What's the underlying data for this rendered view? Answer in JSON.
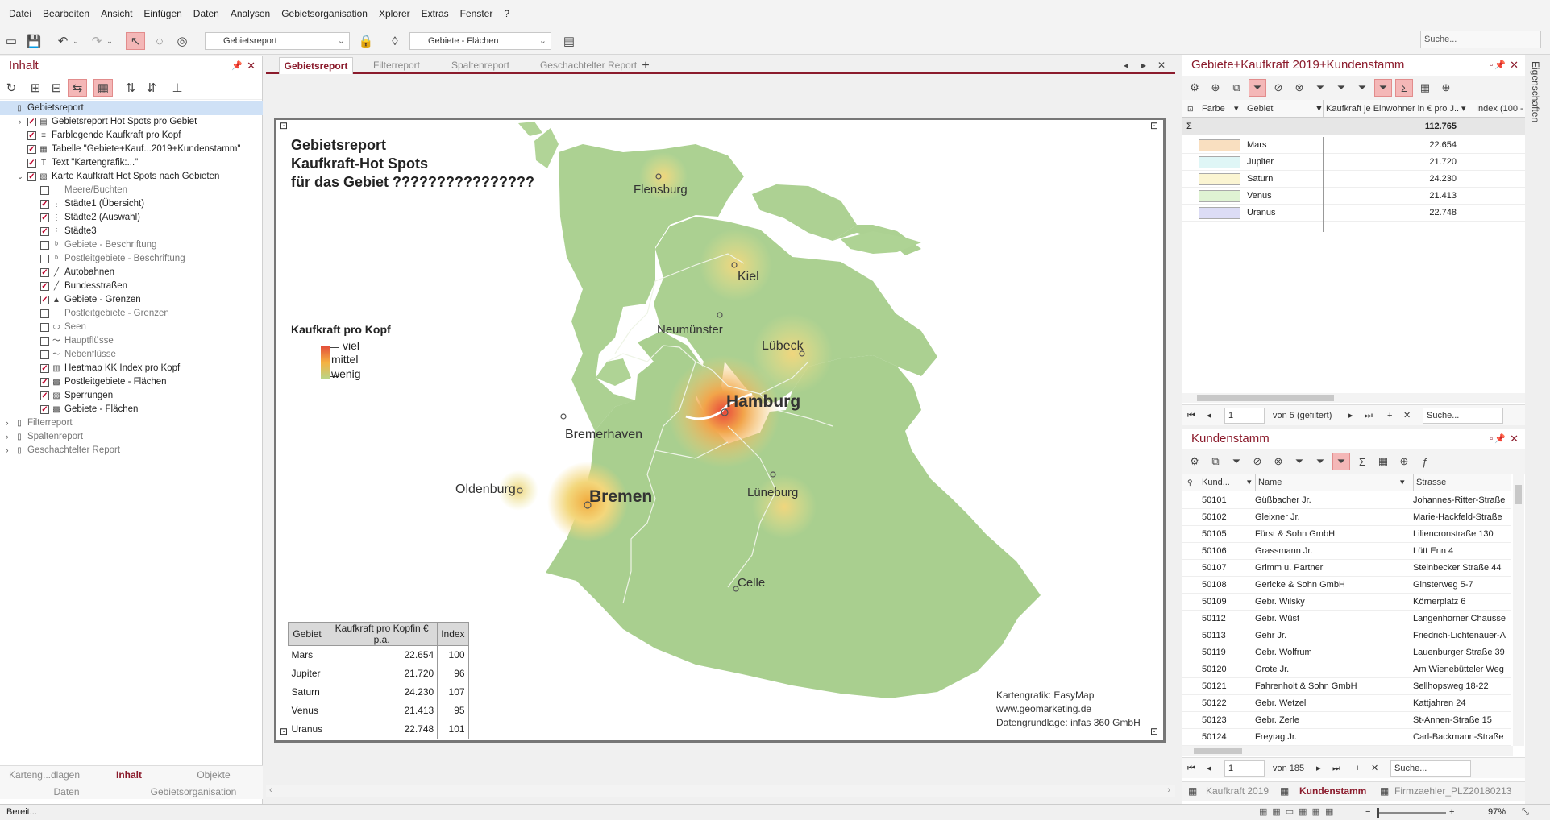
{
  "menu": [
    "Datei",
    "Bearbeiten",
    "Ansicht",
    "Einfügen",
    "Daten",
    "Analysen",
    "Gebietsorganisation",
    "Xplorer",
    "Extras",
    "Fenster",
    "?"
  ],
  "toolbar": {
    "report_combo": "Gebietsreport",
    "layer_combo": "Gebiete - Flächen",
    "search": "Suche..."
  },
  "left": {
    "title": "Inhalt",
    "tree": [
      {
        "label": "Gebietsreport",
        "lvl": 0,
        "exp": "",
        "cb": "none",
        "ic": "doc",
        "sel": true
      },
      {
        "label": "Gebietsreport Hot Spots pro Gebiet",
        "lvl": 1,
        "exp": "›",
        "cb": "on",
        "ic": "rep"
      },
      {
        "label": "Farblegende Kaufkraft pro Kopf",
        "lvl": 1,
        "exp": "",
        "cb": "on",
        "ic": "leg"
      },
      {
        "label": "Tabelle \"Gebiete+Kauf...2019+Kundenstamm\"",
        "lvl": 1,
        "exp": "",
        "cb": "on",
        "ic": "tab"
      },
      {
        "label": "Text \"Kartengrafik:...\"",
        "lvl": 1,
        "exp": "",
        "cb": "on",
        "ic": "txt"
      },
      {
        "label": "Karte Kaufkraft Hot Spots nach Gebieten",
        "lvl": 1,
        "exp": "⌄",
        "cb": "on",
        "ic": "map"
      },
      {
        "label": "Meere/Buchten",
        "lvl": 2,
        "exp": "",
        "cb": "off",
        "ic": "",
        "dim": true
      },
      {
        "label": "Städte1 (Übersicht)",
        "lvl": 2,
        "exp": "",
        "cb": "on",
        "ic": "pt"
      },
      {
        "label": "Städte2 (Auswahl)",
        "lvl": 2,
        "exp": "",
        "cb": "on",
        "ic": "pt"
      },
      {
        "label": "Städte3",
        "lvl": 2,
        "exp": "",
        "cb": "on",
        "ic": "pt"
      },
      {
        "label": "Gebiete - Beschriftung",
        "lvl": 2,
        "exp": "",
        "cb": "off",
        "ic": "lb",
        "dim": true
      },
      {
        "label": "Postleitgebiete - Beschriftung",
        "lvl": 2,
        "exp": "",
        "cb": "off",
        "ic": "lb",
        "dim": true
      },
      {
        "label": "Autobahnen",
        "lvl": 2,
        "exp": "",
        "cb": "on",
        "ic": "ln"
      },
      {
        "label": "Bundesstraßen",
        "lvl": 2,
        "exp": "",
        "cb": "on",
        "ic": "ln2"
      },
      {
        "label": "Gebiete - Grenzen",
        "lvl": 2,
        "exp": "",
        "cb": "on",
        "ic": "gr"
      },
      {
        "label": "Postleitgebiete - Grenzen",
        "lvl": 2,
        "exp": "",
        "cb": "off",
        "ic": "",
        "dim": true
      },
      {
        "label": "Seen",
        "lvl": 2,
        "exp": "",
        "cb": "off",
        "ic": "lake",
        "dim": true
      },
      {
        "label": "Hauptflüsse",
        "lvl": 2,
        "exp": "",
        "cb": "off",
        "ic": "riv",
        "dim": true
      },
      {
        "label": "Nebenflüsse",
        "lvl": 2,
        "exp": "",
        "cb": "off",
        "ic": "riv",
        "dim": true
      },
      {
        "label": "Heatmap KK Index pro Kopf",
        "lvl": 2,
        "exp": "",
        "cb": "on",
        "ic": "heat"
      },
      {
        "label": "Postleitgebiete - Flächen",
        "lvl": 2,
        "exp": "",
        "cb": "on",
        "ic": "area"
      },
      {
        "label": "Sperrungen",
        "lvl": 2,
        "exp": "",
        "cb": "on",
        "ic": "lock"
      },
      {
        "label": "Gebiete - Flächen",
        "lvl": 2,
        "exp": "",
        "cb": "on",
        "ic": "area"
      },
      {
        "label": "Filterreport",
        "lvl": 0,
        "exp": "›",
        "cb": "none",
        "ic": "doc",
        "dim": true
      },
      {
        "label": "Spaltenreport",
        "lvl": 0,
        "exp": "›",
        "cb": "none",
        "ic": "doc",
        "dim": true
      },
      {
        "label": "Geschachtelter Report",
        "lvl": 0,
        "exp": "›",
        "cb": "none",
        "ic": "doc",
        "dim": true
      }
    ],
    "bottom_tabs": [
      "Karteng...dlagen",
      "Inhalt",
      "Objekte"
    ],
    "bottom_tabs2": [
      "Daten",
      "Gebietsorganisation"
    ]
  },
  "center": {
    "tabs": [
      "Gebietsreport",
      "Filterreport",
      "Spaltenreport",
      "Geschachtelter Report"
    ],
    "title_lines": [
      "Gebietsreport",
      "Kaufkraft-Hot Spots",
      "für das Gebiet ????????????????"
    ],
    "legend": {
      "title": "Kaufkraft pro Kopf",
      "high": "viel",
      "mid": "mittel",
      "low": "wenig"
    },
    "cities": [
      {
        "name": "Flensburg",
        "size": "s"
      },
      {
        "name": "Kiel",
        "size": "m"
      },
      {
        "name": "Neumünster",
        "size": "s"
      },
      {
        "name": "Lübeck",
        "size": "m"
      },
      {
        "name": "Hamburg",
        "size": "l"
      },
      {
        "name": "Bremerhaven",
        "size": "m"
      },
      {
        "name": "Oldenburg",
        "size": "m"
      },
      {
        "name": "Bremen",
        "size": "l"
      },
      {
        "name": "Lüneburg",
        "size": "s"
      },
      {
        "name": "Celle",
        "size": "s"
      }
    ],
    "table": {
      "headers": [
        "Gebiet",
        "Kaufkraft pro Kopfin € p.a.",
        "Index"
      ],
      "rows": [
        [
          "Mars",
          "22.654",
          "100"
        ],
        [
          "Jupiter",
          "21.720",
          "96"
        ],
        [
          "Saturn",
          "24.230",
          "107"
        ],
        [
          "Venus",
          "21.413",
          "95"
        ],
        [
          "Uranus",
          "22.748",
          "101"
        ]
      ]
    },
    "credits": [
      "Kartengrafik: EasyMap",
      "www.geomarketing.de",
      "Datengrundlage: infas 360 GmbH"
    ]
  },
  "gridA": {
    "title": "Gebiete+Kaufkraft 2019+Kundenstamm",
    "headers": [
      "Farbe",
      "Gebiet",
      "Kaufkraft je Einwohner in € pro J...",
      "Index (100 -"
    ],
    "sum": "112.765",
    "rows": [
      {
        "name": "Mars",
        "value": "22.654",
        "color": "#f9dfc0"
      },
      {
        "name": "Jupiter",
        "value": "21.720",
        "color": "#dff6f6"
      },
      {
        "name": "Saturn",
        "value": "24.230",
        "color": "#fbf5d2"
      },
      {
        "name": "Venus",
        "value": "21.413",
        "color": "#dff3d3"
      },
      {
        "name": "Uranus",
        "value": "22.748",
        "color": "#dcdcf5"
      }
    ],
    "nav_page": "1",
    "nav_info": "von 5 (gefiltert)",
    "nav_search": "Suche..."
  },
  "gridB": {
    "title": "Kundenstamm",
    "headers": [
      "Kund...",
      "Name",
      "Strasse"
    ],
    "rows": [
      [
        "50101",
        "Güßbacher Jr.",
        "Johannes-Ritter-Straße"
      ],
      [
        "50102",
        "Gleixner Jr.",
        "Marie-Hackfeld-Straße"
      ],
      [
        "50105",
        "Fürst & Sohn GmbH",
        "Liliencronstraße 130"
      ],
      [
        "50106",
        "Grassmann Jr.",
        "Lütt Enn 4"
      ],
      [
        "50107",
        "Grimm u. Partner",
        "Steinbecker Straße 44"
      ],
      [
        "50108",
        "Gericke & Sohn GmbH",
        "Ginsterweg 5-7"
      ],
      [
        "50109",
        "Gebr. Wilsky",
        "Körnerplatz 6"
      ],
      [
        "50112",
        "Gebr. Wüst",
        "Langenhorner Chausse"
      ],
      [
        "50113",
        "Gehr Jr.",
        "Friedrich-Lichtenauer-A"
      ],
      [
        "50119",
        "Gebr. Wolfrum",
        "Lauenburger Straße 39"
      ],
      [
        "50120",
        "Grote Jr.",
        "Am Wienebütteler Weg"
      ],
      [
        "50121",
        "Fahrenholt & Sohn GmbH",
        "Sellhopsweg 18-22"
      ],
      [
        "50122",
        "Gebr. Wetzel",
        "Kattjahren 24"
      ],
      [
        "50123",
        "Gebr. Zerle",
        "St-Annen-Straße 15"
      ],
      [
        "50124",
        "Freytag Jr.",
        "Carl-Backmann-Straße"
      ]
    ],
    "nav_page": "1",
    "nav_info": "von 185",
    "nav_search": "Suche..."
  },
  "bottom_tabs": [
    "Kaufkraft 2019",
    "Kundenstamm",
    "Firmzaehler_PLZ20180213"
  ],
  "side_label": "Eigenschaften",
  "status": {
    "text": "Bereit...",
    "zoom": "97%"
  }
}
